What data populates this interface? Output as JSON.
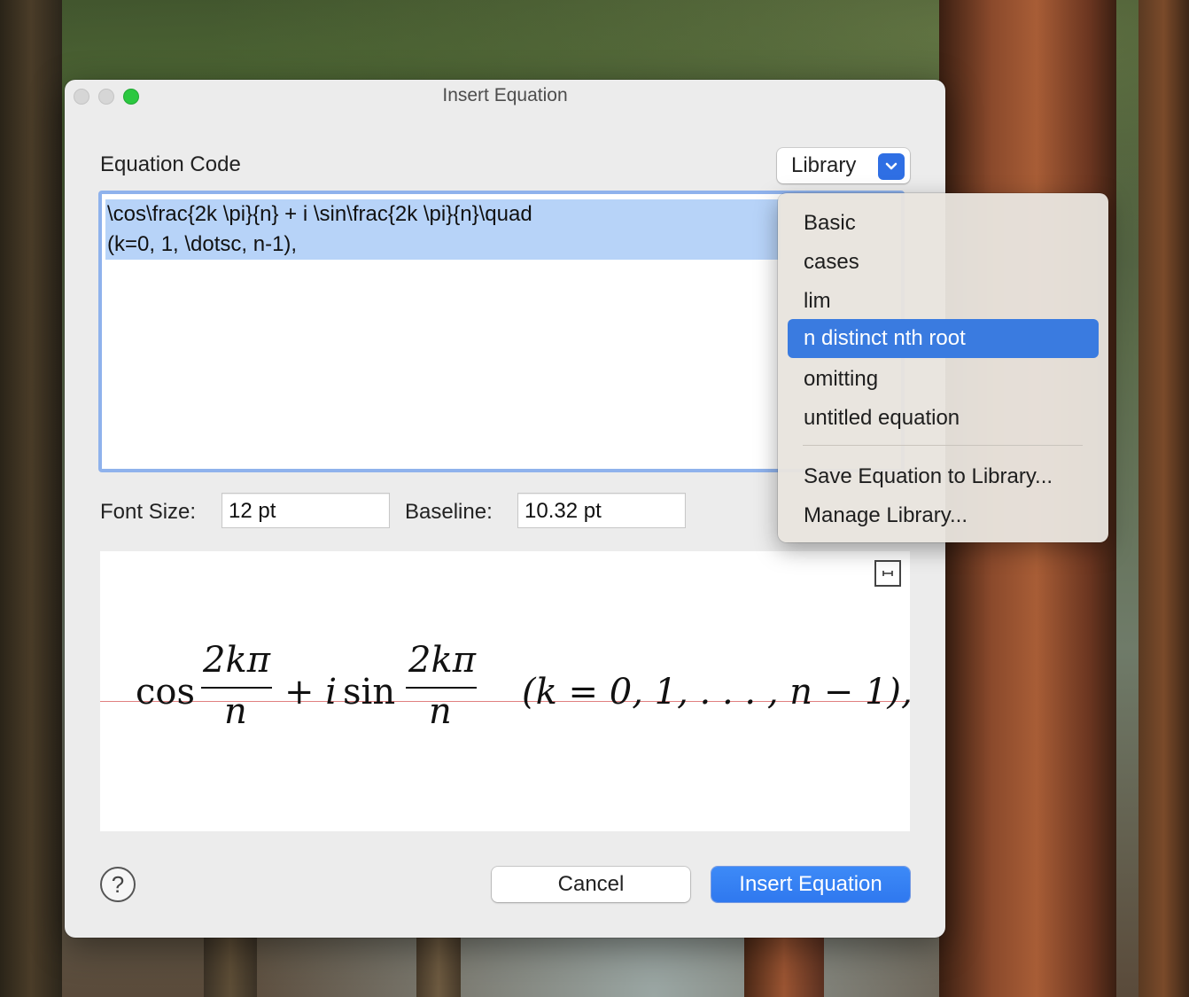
{
  "window": {
    "title": "Insert Equation"
  },
  "equation": {
    "label": "Equation Code",
    "code_lines": [
      "\\cos\\frac{2k \\pi}{n} + i \\sin\\frac{2k \\pi}{n}\\quad",
      "(k=0, 1, \\dotsc, n-1),"
    ]
  },
  "library": {
    "button_label": "Library",
    "items": [
      "Basic",
      "cases",
      "lim",
      "n distinct nth root",
      "omitting",
      "untitled equation"
    ],
    "selected": "n distinct nth root",
    "actions": [
      "Save Equation to Library...",
      "Manage Library..."
    ]
  },
  "font_size": {
    "label": "Font Size:",
    "value": "12 pt"
  },
  "baseline": {
    "label": "Baseline:",
    "value": "10.32 pt"
  },
  "preview": {
    "cos": "cos",
    "num1": "2kπ",
    "den1": "n",
    "plus_i": "+ i",
    "sin": "sin",
    "num2": "2kπ",
    "den2": "n",
    "tail": "(k = 0, 1, . . . , n − 1),"
  },
  "buttons": {
    "help": "?",
    "cancel": "Cancel",
    "insert": "Insert Equation"
  },
  "colors": {
    "accent": "#2f78ef",
    "selection": "#b7d3f8",
    "menu_highlight": "#3a7be0"
  }
}
